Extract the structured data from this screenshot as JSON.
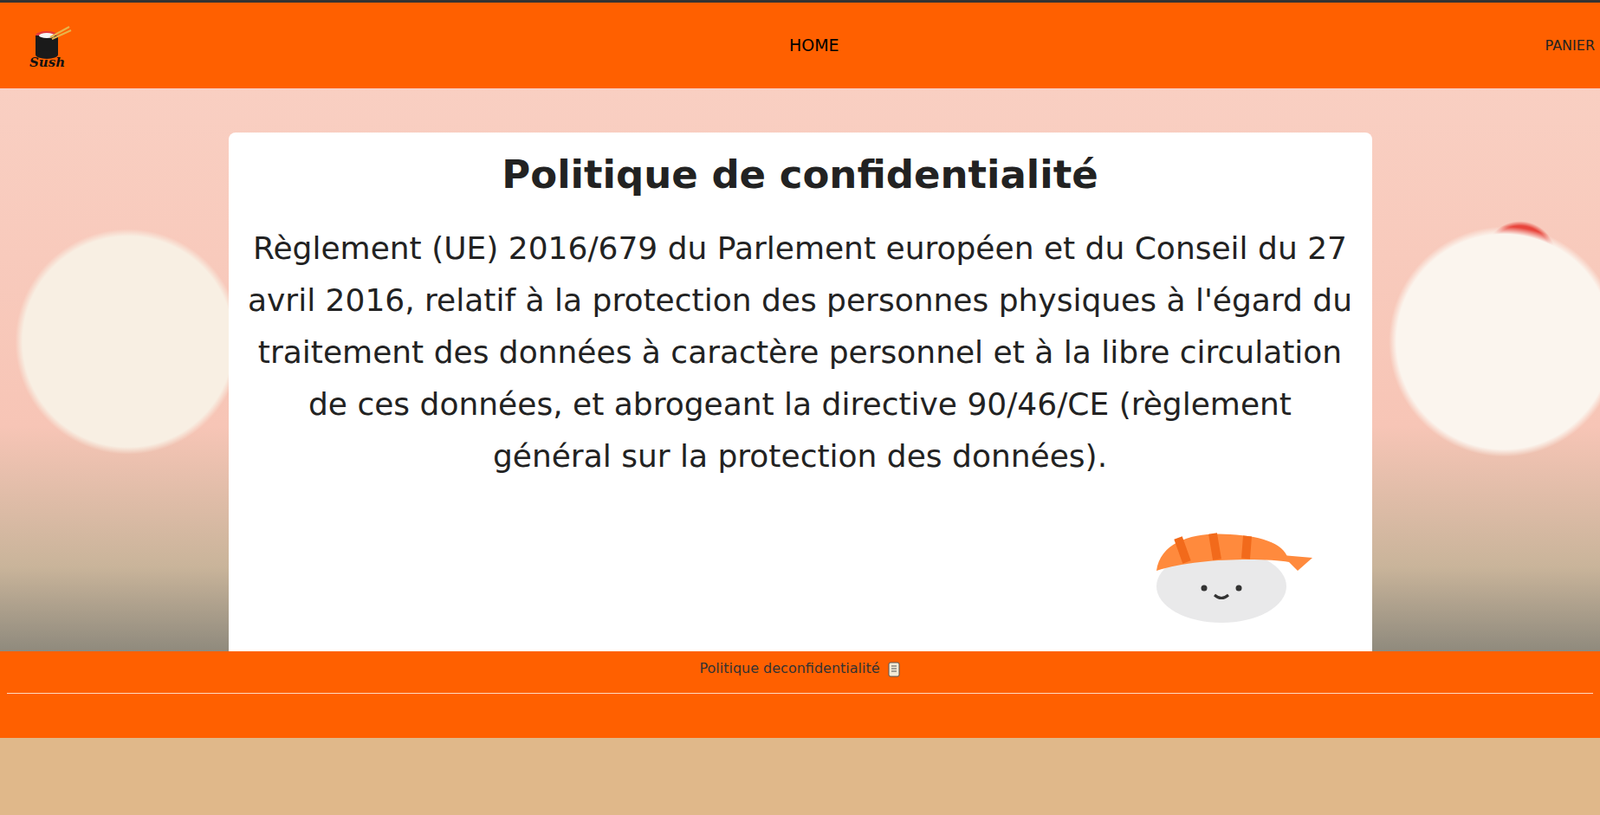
{
  "navbar": {
    "logo_text": "Sush",
    "links": [
      {
        "label": "HOME"
      },
      {
        "label": "PANIER"
      }
    ]
  },
  "content": {
    "title": "Politique de confidentialité",
    "body": "Règlement (UE) 2016/679 du Parlement européen et du Conseil du 27 avril 2016, relatif à la protection des personnes physiques à l'égard du traitement des données à caractère personnel et à la libre circulation de ces données, et abrogeant la directive 90/46/CE (règlement général sur la protection des données)."
  },
  "footer": {
    "link": "Politique deconfidentialité"
  }
}
